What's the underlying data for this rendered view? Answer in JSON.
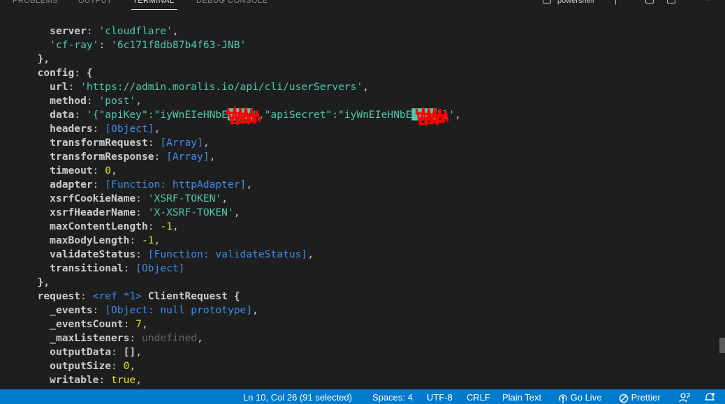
{
  "panel": {
    "tabs": [
      "PROBLEMS",
      "OUTPUT",
      "TERMINAL",
      "DEBUG CONSOLE"
    ],
    "shell": "powershell"
  },
  "terminal": {
    "lines": [
      [
        {
          "t": "    "
        },
        {
          "t": "server",
          "c": "k"
        },
        {
          "t": ": "
        },
        {
          "t": "'cloudflare'",
          "c": "s"
        },
        {
          "t": ","
        }
      ],
      [
        {
          "t": "    "
        },
        {
          "t": "'cf-ray'",
          "c": "s"
        },
        {
          "t": ": "
        },
        {
          "t": "'6c171f8db87b4f63-JNB'",
          "c": "s"
        }
      ],
      [
        {
          "t": "  "
        },
        {
          "t": "},",
          "c": "p"
        }
      ],
      [
        {
          "t": "  "
        },
        {
          "t": "config",
          "c": "k"
        },
        {
          "t": ": "
        },
        {
          "t": "{",
          "c": "p"
        }
      ],
      [
        {
          "t": "    "
        },
        {
          "t": "url",
          "c": "k"
        },
        {
          "t": ": "
        },
        {
          "t": "'https://admin.moralis.io/api/cli/userServers'",
          "c": "s"
        },
        {
          "t": ","
        }
      ],
      [
        {
          "t": "    "
        },
        {
          "t": "method",
          "c": "k"
        },
        {
          "t": ": "
        },
        {
          "t": "'post'",
          "c": "s"
        },
        {
          "t": ","
        }
      ],
      [
        {
          "t": "    "
        },
        {
          "t": "data",
          "c": "k"
        },
        {
          "t": ": "
        },
        {
          "t": "'{\"apiKey\":\"iyWnEIeHNbE████\",\"apiSecret\":\"iyWnEIeHNbE████\"}'",
          "c": "s"
        },
        {
          "t": ","
        }
      ],
      [
        {
          "t": "    "
        },
        {
          "t": "headers",
          "c": "k"
        },
        {
          "t": ": "
        },
        {
          "t": "[Object]",
          "c": "o"
        },
        {
          "t": ","
        }
      ],
      [
        {
          "t": "    "
        },
        {
          "t": "transformRequest",
          "c": "k"
        },
        {
          "t": ": "
        },
        {
          "t": "[Array]",
          "c": "o"
        },
        {
          "t": ","
        }
      ],
      [
        {
          "t": "    "
        },
        {
          "t": "transformResponse",
          "c": "k"
        },
        {
          "t": ": "
        },
        {
          "t": "[Array]",
          "c": "o"
        },
        {
          "t": ","
        }
      ],
      [
        {
          "t": "    "
        },
        {
          "t": "timeout",
          "c": "k"
        },
        {
          "t": ": "
        },
        {
          "t": "0",
          "c": "n"
        },
        {
          "t": ","
        }
      ],
      [
        {
          "t": "    "
        },
        {
          "t": "adapter",
          "c": "k"
        },
        {
          "t": ": "
        },
        {
          "t": "[Function: httpAdapter]",
          "c": "o"
        },
        {
          "t": ","
        }
      ],
      [
        {
          "t": "    "
        },
        {
          "t": "xsrfCookieName",
          "c": "k"
        },
        {
          "t": ": "
        },
        {
          "t": "'XSRF-TOKEN'",
          "c": "s"
        },
        {
          "t": ","
        }
      ],
      [
        {
          "t": "    "
        },
        {
          "t": "xsrfHeaderName",
          "c": "k"
        },
        {
          "t": ": "
        },
        {
          "t": "'X-XSRF-TOKEN'",
          "c": "s"
        },
        {
          "t": ","
        }
      ],
      [
        {
          "t": "    "
        },
        {
          "t": "maxContentLength",
          "c": "k"
        },
        {
          "t": ": "
        },
        {
          "t": "-1",
          "c": "n"
        },
        {
          "t": ","
        }
      ],
      [
        {
          "t": "    "
        },
        {
          "t": "maxBodyLength",
          "c": "k"
        },
        {
          "t": ": "
        },
        {
          "t": "-1",
          "c": "n"
        },
        {
          "t": ","
        }
      ],
      [
        {
          "t": "    "
        },
        {
          "t": "validateStatus",
          "c": "k"
        },
        {
          "t": ": "
        },
        {
          "t": "[Function: validateStatus]",
          "c": "o"
        },
        {
          "t": ","
        }
      ],
      [
        {
          "t": "    "
        },
        {
          "t": "transitional",
          "c": "k"
        },
        {
          "t": ": "
        },
        {
          "t": "[Object]",
          "c": "o"
        }
      ],
      [
        {
          "t": "  "
        },
        {
          "t": "},",
          "c": "p"
        }
      ],
      [
        {
          "t": "  "
        },
        {
          "t": "request",
          "c": "k"
        },
        {
          "t": ": "
        },
        {
          "t": "<ref *1>",
          "c": "o"
        },
        {
          "t": " "
        },
        {
          "t": "ClientRequest {",
          "c": "p"
        }
      ],
      [
        {
          "t": "    "
        },
        {
          "t": "_events",
          "c": "k"
        },
        {
          "t": ": "
        },
        {
          "t": "[Object: null prototype]",
          "c": "o"
        },
        {
          "t": ","
        }
      ],
      [
        {
          "t": "    "
        },
        {
          "t": "_eventsCount",
          "c": "k"
        },
        {
          "t": ": "
        },
        {
          "t": "7",
          "c": "n"
        },
        {
          "t": ","
        }
      ],
      [
        {
          "t": "    "
        },
        {
          "t": "_maxListeners",
          "c": "k"
        },
        {
          "t": ": "
        },
        {
          "t": "undefined",
          "c": "u"
        },
        {
          "t": ","
        }
      ],
      [
        {
          "t": "    "
        },
        {
          "t": "outputData",
          "c": "k"
        },
        {
          "t": ": "
        },
        {
          "t": "[]",
          "c": "p"
        },
        {
          "t": ","
        }
      ],
      [
        {
          "t": "    "
        },
        {
          "t": "outputSize",
          "c": "k"
        },
        {
          "t": ": "
        },
        {
          "t": "0",
          "c": "n"
        },
        {
          "t": ","
        }
      ],
      [
        {
          "t": "    "
        },
        {
          "t": "writable",
          "c": "k"
        },
        {
          "t": ": "
        },
        {
          "t": "true",
          "c": "b"
        },
        {
          "t": ","
        }
      ]
    ]
  },
  "statusbar": {
    "cursor": "Ln 10, Col 26 (91 selected)",
    "spaces": "Spaces: 4",
    "encoding": "UTF-8",
    "eol": "CRLF",
    "language": "Plain Text",
    "golive": "Go Live",
    "prettier": "Prettier"
  },
  "colors": {
    "background": "#1e1e1e",
    "statusbar": "#007acc",
    "string": "#4ec9b0",
    "number": "#e5e510",
    "object": "#3b8eea",
    "redaction": "#ff0000"
  }
}
